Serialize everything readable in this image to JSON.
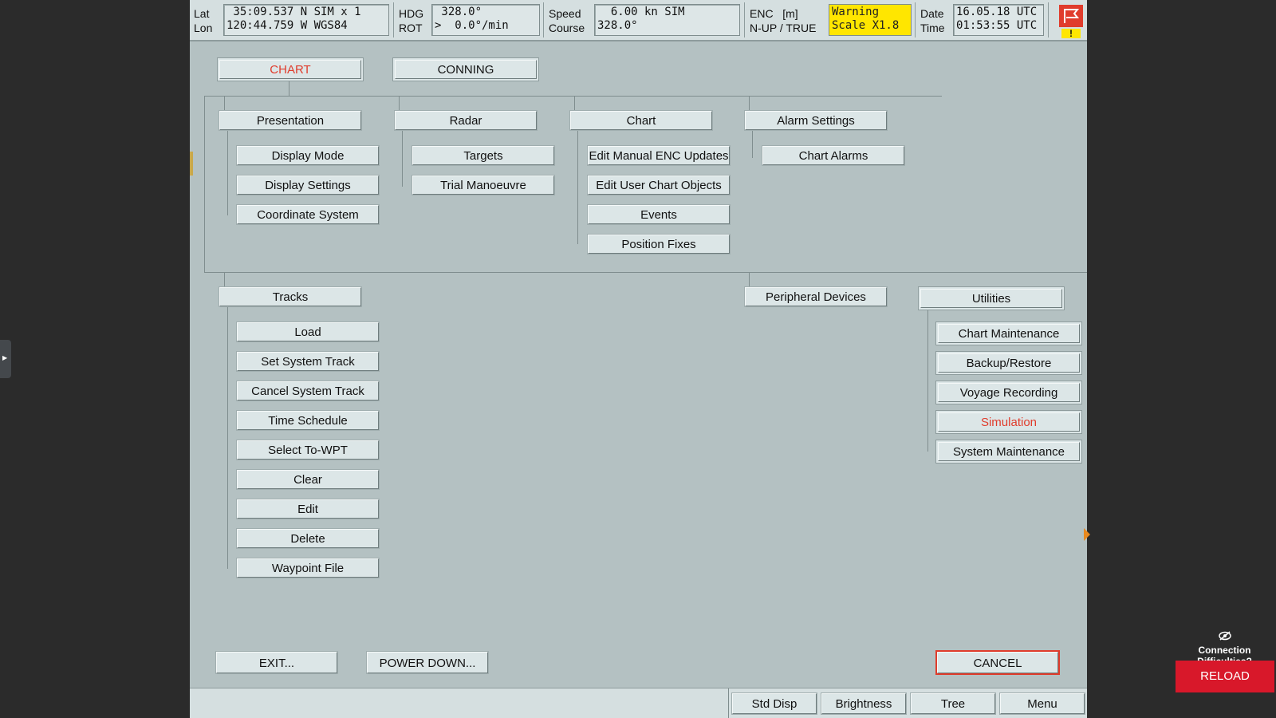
{
  "topbar": {
    "lat_label": "Lat",
    "lon_label": "Lon",
    "lat_value": " 35:09.537 N SIM x 1",
    "lon_value": "120:44.759 W WGS84",
    "hdg_label": "HDG",
    "rot_label": "ROT",
    "hdg_value": " 328.0°",
    "rot_value": ">  0.0°/min",
    "speed_label": "Speed",
    "course_label": "Course",
    "speed_value": "  6.00 kn SIM",
    "course_value": "328.0°",
    "enc_label": "ENC   [m]",
    "orientation_label": "N-UP / TRUE",
    "warning_line1": "Warning",
    "warning_line2": "Scale X1.8",
    "date_label": "Date",
    "time_label": "Time",
    "date_value": "16.05.18 UTC",
    "time_value": "01:53:55 UTC",
    "alarm_flag_mark": "!",
    "warning_color": "#ffe600",
    "alarm_color": "#e03c2c"
  },
  "menu": {
    "top": {
      "chart": "CHART",
      "conning": "CONNING"
    },
    "presentation": {
      "label": "Presentation",
      "items": [
        "Display Mode",
        "Display Settings",
        "Coordinate System"
      ]
    },
    "radar": {
      "label": "Radar",
      "items": [
        "Targets",
        "Trial Manoeuvre"
      ]
    },
    "chart": {
      "label": "Chart",
      "items": [
        "Edit Manual ENC Updates",
        "Edit User Chart Objects",
        "Events",
        "Position Fixes"
      ]
    },
    "alarm_settings": {
      "label": "Alarm Settings",
      "items": [
        "Chart Alarms"
      ]
    },
    "tracks": {
      "label": "Tracks",
      "items": [
        "Load",
        "Set System Track",
        "Cancel System Track",
        "Time Schedule",
        "Select To-WPT",
        "Clear",
        "Edit",
        "Delete",
        "Waypoint File"
      ]
    },
    "peripheral_devices": {
      "label": "Peripheral Devices"
    },
    "utilities": {
      "label": "Utilities",
      "items": [
        "Chart Maintenance",
        "Backup/Restore",
        "Voyage Recording",
        "Simulation",
        "System Maintenance"
      ],
      "active_item": "Simulation"
    }
  },
  "actions": {
    "exit": "EXIT...",
    "power_down": "POWER DOWN...",
    "cancel": "CANCEL"
  },
  "bottombar": {
    "std_disp": "Std Disp",
    "brightness": "Brightness",
    "tree": "Tree",
    "menu": "Menu"
  },
  "overlay": {
    "connection_text": "Connection Difficulties?",
    "reload": "RELOAD"
  }
}
